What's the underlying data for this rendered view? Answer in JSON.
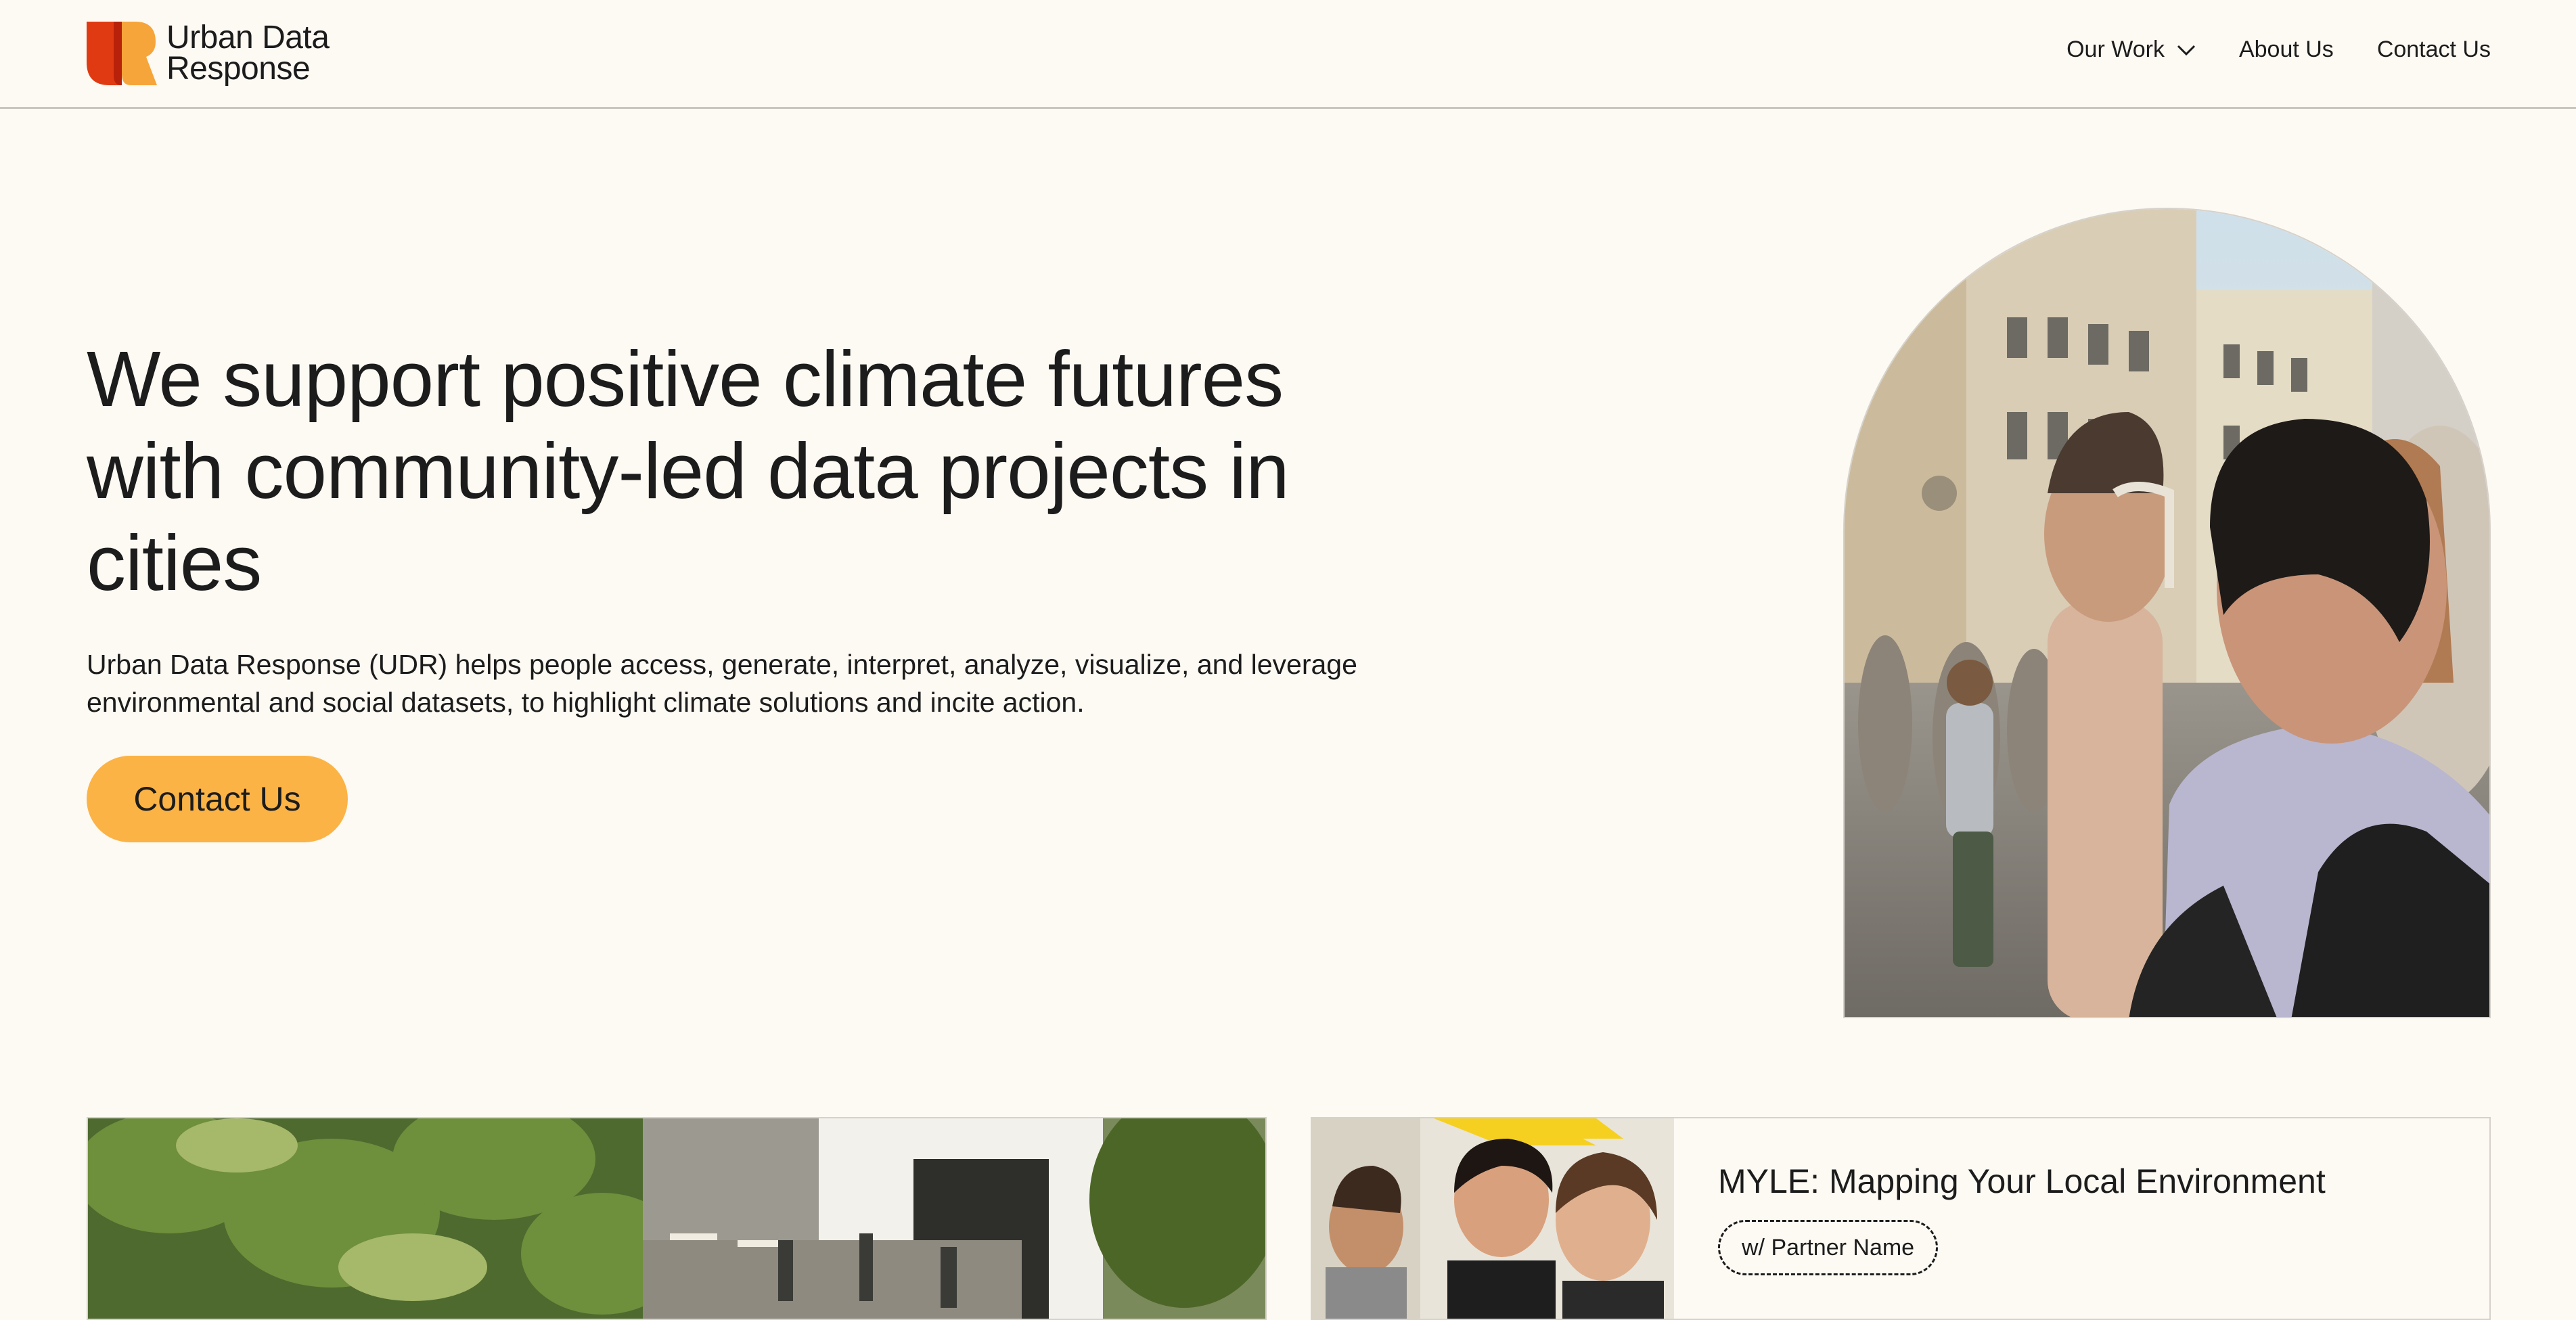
{
  "header": {
    "logo_line1": "Urban Data",
    "logo_line2": "Response",
    "nav": {
      "our_work": "Our Work",
      "about": "About Us",
      "contact": "Contact Us"
    }
  },
  "hero": {
    "title_line1": "We support positive climate futures",
    "title_line2": "with community-led data projects in",
    "title_line3": "cities",
    "description_line1": "Urban Data Response (UDR) helps people access, generate, interpret, analyze, visualize, and leverage",
    "description_line2": "environmental and social datasets, to highlight climate solutions and incite action.",
    "cta": "Contact Us"
  },
  "projects": {
    "featured": {
      "title": "MYLE: Mapping Your Local Environment",
      "partner": "w/ Partner Name"
    }
  },
  "colors": {
    "background": "#fdf9f3",
    "accent": "#fbb345",
    "logo_red": "#e03a12",
    "logo_orange": "#f6a53a",
    "text": "#1c1c1c"
  }
}
